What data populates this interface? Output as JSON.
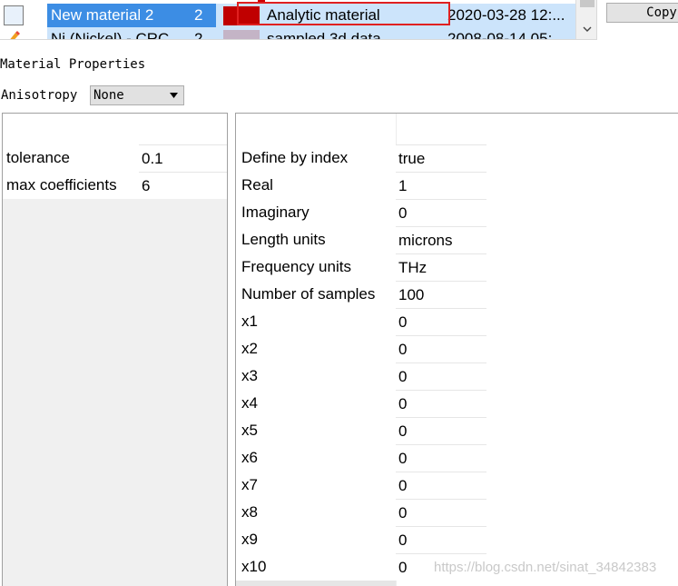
{
  "materials": [
    {
      "name": "New material 2",
      "id": "2",
      "color": "#c00000",
      "type": "Analytic material",
      "date": "2020-03-28 12:...",
      "selected": true
    },
    {
      "name": "Ni (Nickel) - CRC",
      "id": "2",
      "color": "#c4b4c6",
      "type": "sampled 3d data",
      "date": "2008-08-14 05:",
      "selected": false
    }
  ],
  "copy_button": "Copy",
  "properties": {
    "title": "Material Properties",
    "anisotropy_label": "Anisotropy",
    "anisotropy_value": "None"
  },
  "left_panel": [
    {
      "key": "tolerance",
      "value": "0.1"
    },
    {
      "key": "max coefficients",
      "value": "6"
    }
  ],
  "right_panel": [
    {
      "key": "Define by index",
      "value": "true"
    },
    {
      "key": "Real",
      "value": "1"
    },
    {
      "key": "Imaginary",
      "value": "0"
    },
    {
      "key": "Length units",
      "value": "microns"
    },
    {
      "key": "Frequency units",
      "value": "THz"
    },
    {
      "key": "Number of samples",
      "value": "100"
    },
    {
      "key": "x1",
      "value": "0"
    },
    {
      "key": "x2",
      "value": "0"
    },
    {
      "key": "x3",
      "value": "0"
    },
    {
      "key": "x4",
      "value": "0"
    },
    {
      "key": "x5",
      "value": "0"
    },
    {
      "key": "x6",
      "value": "0"
    },
    {
      "key": "x7",
      "value": "0"
    },
    {
      "key": "x8",
      "value": "0"
    },
    {
      "key": "x9",
      "value": "0"
    },
    {
      "key": "x10",
      "value": "0"
    }
  ],
  "watermark": "https://blog.csdn.net/sinat_34842383",
  "colors": {
    "selection": "#3c8de4",
    "selection_light": "#cce4fb",
    "highlight_border": "#e02020"
  }
}
